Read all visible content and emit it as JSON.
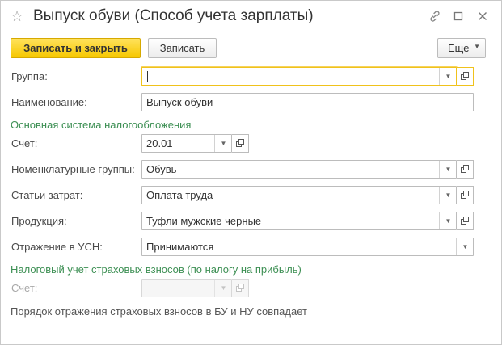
{
  "window": {
    "title": "Выпуск обуви (Способ учета зарплаты)",
    "icons": [
      "star-icon",
      "link-icon",
      "maximize-icon",
      "close-icon"
    ]
  },
  "toolbar": {
    "save_close_label": "Записать и закрыть",
    "save_label": "Записать",
    "more_label": "Еще"
  },
  "form": {
    "group": {
      "label": "Группа:",
      "value": ""
    },
    "name": {
      "label": "Наименование:",
      "value": "Выпуск обуви"
    },
    "section_main": "Основная система налогообложения",
    "account": {
      "label": "Счет:",
      "value": "20.01"
    },
    "nomenclature": {
      "label": "Номенклатурные группы:",
      "value": "Обувь"
    },
    "cost_item": {
      "label": "Статьи затрат:",
      "value": "Оплата труда"
    },
    "product": {
      "label": "Продукция:",
      "value": "Туфли мужские черные"
    },
    "usn": {
      "label": "Отражение в УСН:",
      "value": "Принимаются"
    },
    "section_tax": "Налоговый учет страховых взносов (по налогу на прибыль)",
    "tax_account": {
      "label": "Счет:",
      "value": ""
    },
    "note": "Порядок отражения страховых взносов в БУ и НУ совпадает"
  },
  "colors": {
    "accent": "#f6c700",
    "section_green": "#3c8f53",
    "focus_border": "#f0c21b"
  }
}
